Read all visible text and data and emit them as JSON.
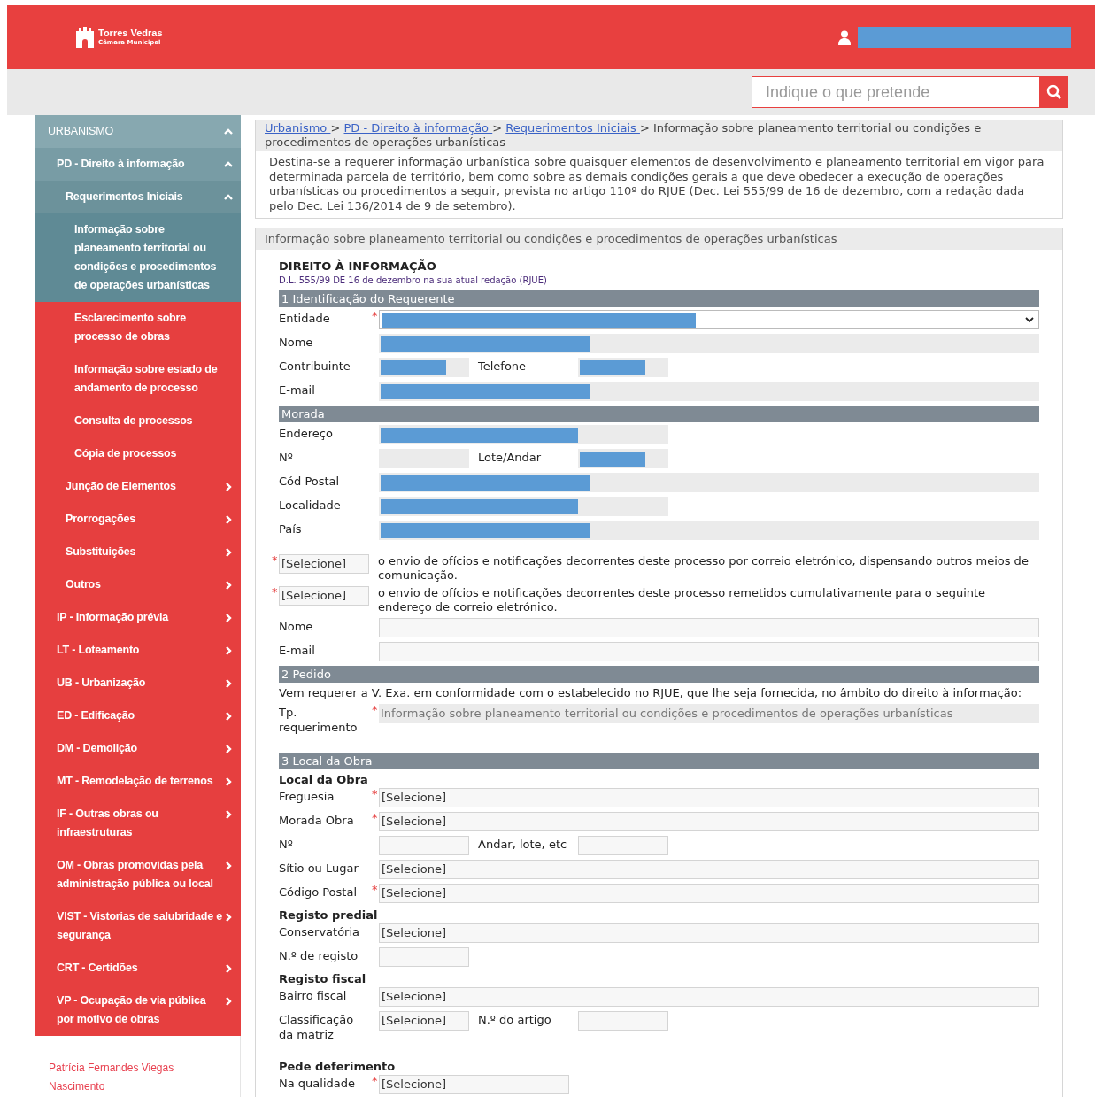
{
  "header": {
    "logo_title": "Torres Vedras",
    "logo_subtitle": "Câmara Municipal",
    "user_redacted": true
  },
  "search": {
    "placeholder": "Indique o que pretende"
  },
  "sidebar": {
    "items": [
      {
        "label": "URBANISMO",
        "expanded": true,
        "selected": false,
        "children": [
          {
            "label": "PD - Direito à informação",
            "expanded": true,
            "selected": false,
            "children": [
              {
                "label": "Requerimentos Iniciais",
                "expanded": true,
                "selected": false,
                "children": [
                  {
                    "label": "Informação sobre planeamento territorial ou condições e procedimentos de operações urbanísticas",
                    "selected": true
                  },
                  {
                    "label": "Esclarecimento sobre processo de obras",
                    "selected": false
                  },
                  {
                    "label": "Informação sobre estado de andamento de processo",
                    "selected": false
                  },
                  {
                    "label": "Consulta de processos",
                    "selected": false
                  },
                  {
                    "label": "Cópia de processos",
                    "selected": false
                  }
                ]
              },
              {
                "label": "Junção de Elementos",
                "expanded": false,
                "selected": false
              },
              {
                "label": "Prorrogações",
                "expanded": false,
                "selected": false
              },
              {
                "label": "Substituições",
                "expanded": false,
                "selected": false
              },
              {
                "label": "Outros",
                "expanded": false,
                "selected": false
              }
            ]
          },
          {
            "label": "IP - Informação prévia",
            "expanded": false,
            "selected": false
          },
          {
            "label": "LT - Loteamento",
            "expanded": false,
            "selected": false
          },
          {
            "label": "UB - Urbanização",
            "expanded": false,
            "selected": false
          },
          {
            "label": "ED - Edificação",
            "expanded": false,
            "selected": false
          },
          {
            "label": "DM - Demolição",
            "expanded": false,
            "selected": false
          },
          {
            "label": "MT - Remodelação de terrenos",
            "expanded": false,
            "selected": false
          },
          {
            "label": "IF - Outras obras ou infraestruturas",
            "expanded": false,
            "selected": false
          },
          {
            "label": "OM - Obras promovidas pela administração pública ou local",
            "expanded": false,
            "selected": false
          },
          {
            "label": "VIST - Vistorias de salubridade e segurança",
            "expanded": false,
            "selected": false
          },
          {
            "label": "CRT - Certidões",
            "expanded": false,
            "selected": false
          },
          {
            "label": "VP - Ocupação de via pública por motivo de obras",
            "expanded": false,
            "selected": false
          }
        ]
      }
    ],
    "user_name": "Patrícia Fernandes Viegas Nascimento"
  },
  "breadcrumb": {
    "links": [
      "Urbanismo ",
      "PD - Direito à informação ",
      "Requerimentos Iniciais "
    ],
    "separator": ">",
    "current": "Informação sobre planeamento territorial ou condições e procedimentos de operações urbanísticas"
  },
  "description": "Destina-se a requerer informação urbanística sobre quaisquer elementos de desenvolvimento e planeamento territorial em vigor para determinada parcela de território, bem como sobre as demais condições gerais a que deve obedecer a execução de operações urbanísticas ou procedimentos a seguir, prevista no artigo 110º do RJUE (Dec. Lei 555/99 de 16 de dezembro, com a redação dada pelo Dec. Lei 136/2014 de 9 de setembro).",
  "form": {
    "panel_title": "Informação sobre planeamento territorial ou condições e procedimentos de operações urbanísticas",
    "title": "DIREITO À INFORMAÇÃO",
    "subtitle": "D.L. 555/99 DE 16 de dezembro na sua atual redação (RJUE)",
    "items": [
      {
        "kind": "bar",
        "text": "1 Identificação do Requerente"
      },
      {
        "kind": "row",
        "cells": [
          {
            "label": "Entidade",
            "mark": "*",
            "kind": "select",
            "redacted": true
          }
        ]
      },
      {
        "kind": "row",
        "cells": [
          {
            "label": "Nome",
            "kind": "greywide",
            "redacted": true
          }
        ]
      },
      {
        "kind": "row",
        "cells": [
          {
            "label": "Contribuinte",
            "kind": "greyshort",
            "redacted": true
          },
          {
            "label": "Telefone",
            "kind": "greyshort",
            "redacted": true
          }
        ]
      },
      {
        "kind": "row",
        "cells": [
          {
            "label": "E-mail",
            "kind": "greywide",
            "redacted": true
          }
        ]
      },
      {
        "kind": "bar",
        "text": "Morada"
      },
      {
        "kind": "row",
        "cells": [
          {
            "label": "Endereço",
            "kind": "greymedium",
            "redacted": true
          }
        ]
      },
      {
        "kind": "row",
        "cells": [
          {
            "label": "Nº",
            "kind": "greyshort"
          },
          {
            "label": "Lote/Andar",
            "kind": "greyshort",
            "redacted": true
          }
        ]
      },
      {
        "kind": "row",
        "cells": [
          {
            "label": "Cód Postal",
            "kind": "greywide",
            "redacted": true
          }
        ]
      },
      {
        "kind": "row",
        "cells": [
          {
            "label": "Localidade",
            "kind": "greymedium",
            "redacted": true
          }
        ]
      },
      {
        "kind": "row",
        "cells": [
          {
            "label": "País",
            "kind": "greywide",
            "redacted": true
          }
        ]
      },
      {
        "kind": "spacer"
      },
      {
        "kind": "choice",
        "mark": "*",
        "value": "[Selecione]",
        "text": "o envio de ofícios e notificações decorrentes deste processo por correio eletrónico, dispensando outros meios de comunicação."
      },
      {
        "kind": "choice",
        "mark": "*",
        "value": "[Selecione]",
        "text": "o envio de ofícios e notificações decorrentes deste processo remetidos cumulativamente para o seguinte endereço de correio eletrónico."
      },
      {
        "kind": "row",
        "cells": [
          {
            "label": "Nome",
            "kind": "boxwide"
          }
        ]
      },
      {
        "kind": "row",
        "cells": [
          {
            "label": "E-mail",
            "kind": "boxwide"
          }
        ]
      },
      {
        "kind": "bar",
        "text": "2 Pedido"
      },
      {
        "kind": "text",
        "text": "Vem requerer a V. Exa. em conformidade com o estabelecido no RJUE, que lhe seja fornecida, no âmbito do direito à informação:"
      },
      {
        "kind": "row",
        "cells": [
          {
            "label": "Tp. requerimento",
            "mark": "*",
            "kind": "greywide",
            "value": "Informação sobre planeamento territorial ou condições e procedimentos de operações urbanísticas"
          }
        ]
      },
      {
        "kind": "spacer"
      },
      {
        "kind": "bar",
        "text": "3 Local da Obra"
      },
      {
        "kind": "heading",
        "text": "Local da Obra"
      },
      {
        "kind": "row",
        "cells": [
          {
            "label": "Freguesia",
            "mark": "*",
            "kind": "boxwide",
            "value": "[Selecione]"
          }
        ]
      },
      {
        "kind": "row",
        "cells": [
          {
            "label": "Morada Obra",
            "mark": "*",
            "kind": "boxwide",
            "value": "[Selecione]"
          }
        ]
      },
      {
        "kind": "row",
        "cells": [
          {
            "label": "Nº",
            "kind": "boxshort"
          },
          {
            "label": "Andar, lote, etc",
            "kind": "boxshort"
          }
        ]
      },
      {
        "kind": "row",
        "cells": [
          {
            "label": "Sítio ou Lugar",
            "kind": "boxwide",
            "value": "[Selecione]"
          }
        ]
      },
      {
        "kind": "row",
        "cells": [
          {
            "label": "Código Postal",
            "mark": "*",
            "kind": "boxwide",
            "value": "[Selecione]"
          }
        ]
      },
      {
        "kind": "heading",
        "text": "Registo predial"
      },
      {
        "kind": "row",
        "cells": [
          {
            "label": "Conservatória",
            "kind": "boxwide",
            "value": "[Selecione]"
          }
        ]
      },
      {
        "kind": "row",
        "cells": [
          {
            "label": "N.º de registo",
            "kind": "boxshort"
          }
        ]
      },
      {
        "kind": "heading",
        "text": "Registo fiscal"
      },
      {
        "kind": "row",
        "cells": [
          {
            "label": "Bairro fiscal",
            "kind": "boxwide",
            "value": "[Selecione]"
          }
        ]
      },
      {
        "kind": "row",
        "cells": [
          {
            "label": "Classificação da matriz",
            "kind": "boxshort",
            "value": "[Selecione]"
          },
          {
            "label": "N.º do artigo",
            "kind": "boxshort"
          }
        ]
      },
      {
        "kind": "spacer"
      },
      {
        "kind": "heading",
        "text": "Pede deferimento"
      },
      {
        "kind": "row",
        "cells": [
          {
            "label": "Na qualidade",
            "mark": "*",
            "kind": "boxmedium",
            "value": "[Selecione]"
          }
        ]
      }
    ]
  }
}
